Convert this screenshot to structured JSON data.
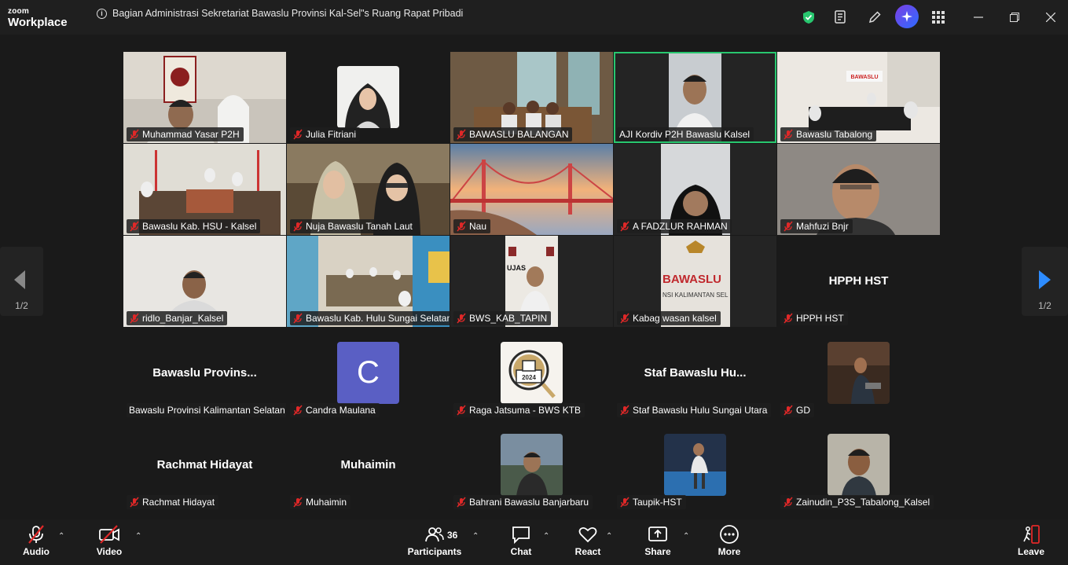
{
  "app": {
    "logo_top": "zoom",
    "logo_bottom": "Workplace"
  },
  "meeting": {
    "title": "Bagian Administrasi Sekretariat Bawaslu Provinsi Kal-Sel\"s Ruang Rapat Pribadi"
  },
  "pagination": {
    "left_label": "1/2",
    "right_label": "1/2"
  },
  "tiles": [
    {
      "name": "Muhammad Yasar P2H"
    },
    {
      "name": "Julia Fitriani"
    },
    {
      "name": "BAWASLU BALANGAN"
    },
    {
      "name": "AJI Kordiv P2H Bawaslu Kalsel"
    },
    {
      "name": "Bawaslu Tabalong"
    },
    {
      "name": "Bawaslu Kab. HSU - Kalsel"
    },
    {
      "name": "Nuja Bawaslu Tanah Laut"
    },
    {
      "name": "Nau"
    },
    {
      "name": "A FADZLUR RAHMAN"
    },
    {
      "name": "Mahfuzi Bnjr"
    },
    {
      "name": "ridlo_Banjar_Kalsel"
    },
    {
      "name": "Bawaslu Kab. Hulu Sungai Selatan"
    },
    {
      "name": "BWS_KAB_TAPIN"
    },
    {
      "name": "Kabag wasan kalsel"
    },
    {
      "name": "HPPH HST",
      "big": "HPPH HST"
    },
    {
      "name": "Bawaslu Provinsi Kalimantan Selatan",
      "big": "Bawaslu  Provins..."
    },
    {
      "name": "Candra Maulana",
      "letter": "C"
    },
    {
      "name": "Raga Jatsuma - BWS KTB",
      "badge_year": "2024"
    },
    {
      "name": "Staf Bawaslu Hulu Sungai Utara",
      "big": "Staf Bawaslu Hu..."
    },
    {
      "name": "GD"
    },
    {
      "name": "Rachmat Hidayat",
      "big": "Rachmat Hidayat"
    },
    {
      "name": "Muhaimin",
      "big": "Muhaimin"
    },
    {
      "name": "Bahrani Bawaslu Banjarbaru"
    },
    {
      "name": "Taupik-HST"
    },
    {
      "name": "Zainudin_P3S_Tabalong_Kalsel"
    }
  ],
  "scene_text": {
    "bawaslu_sign": "BAWASLU",
    "bawaslu_sign_sub": "NSI KALIMANTAN SEL",
    "tapin_sign": "UJAS"
  },
  "toolbar": {
    "audio": "Audio",
    "video": "Video",
    "participants": "Participants",
    "participants_count": "36",
    "chat": "Chat",
    "react": "React",
    "share": "Share",
    "more": "More",
    "leave": "Leave"
  },
  "colors": {
    "active_border": "#28c76f",
    "leave": "#e02828",
    "mute": "#e02828",
    "avatar_c": "#5a5fc4",
    "arrow_blue": "#2d8cff"
  }
}
